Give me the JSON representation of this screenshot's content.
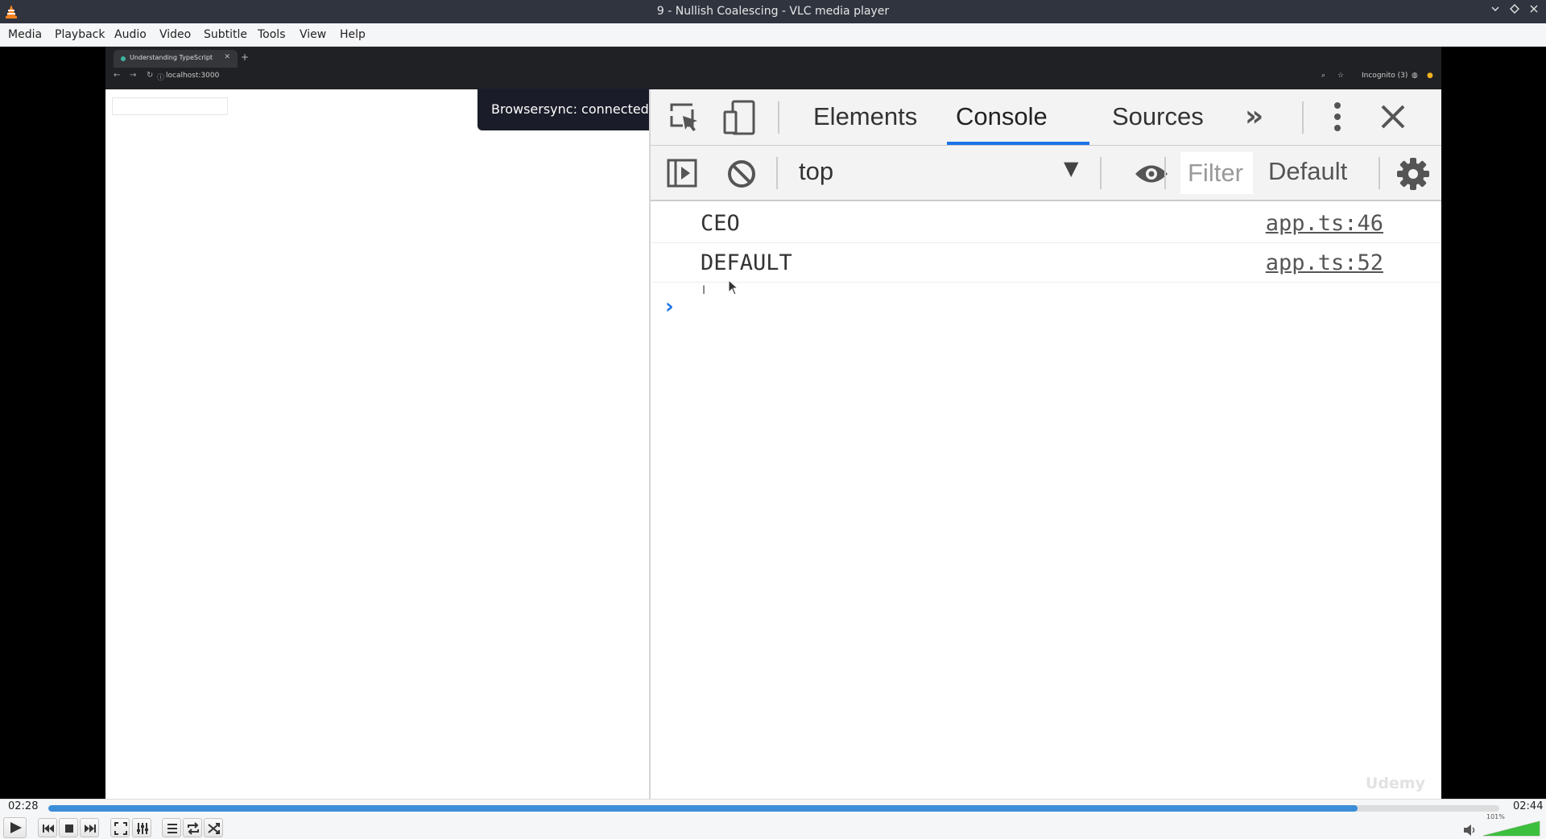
{
  "window": {
    "title": "9 - Nullish Coalescing - VLC media player",
    "icon": "vlc-cone-icon"
  },
  "menu": [
    "Media",
    "Playback",
    "Audio",
    "Video",
    "Subtitle",
    "Tools",
    "View",
    "Help"
  ],
  "browser": {
    "tab_title": "Understanding TypeScript",
    "url": "localhost:3000",
    "profile": "Incognito (3)"
  },
  "tooltip": "Browsersync: connected",
  "devtools": {
    "tabs": [
      "Elements",
      "Console",
      "Sources"
    ],
    "active_tab": "Console",
    "context": "top",
    "filter_placeholder": "Filter",
    "levels": "Default",
    "logs": [
      {
        "message": "CEO",
        "source": "app.ts:46"
      },
      {
        "message": "DEFAULT",
        "source": "app.ts:52"
      }
    ],
    "text_cursor": "I"
  },
  "watermark": "Udemy",
  "player": {
    "elapsed": "02:28",
    "duration": "02:44",
    "progress": 0.9024,
    "volume_label": "101%",
    "volume": 1.01,
    "colors": {
      "seek": "#3b8ed7",
      "volume": "#3cbf3c",
      "accent": "#1a73e8"
    }
  }
}
